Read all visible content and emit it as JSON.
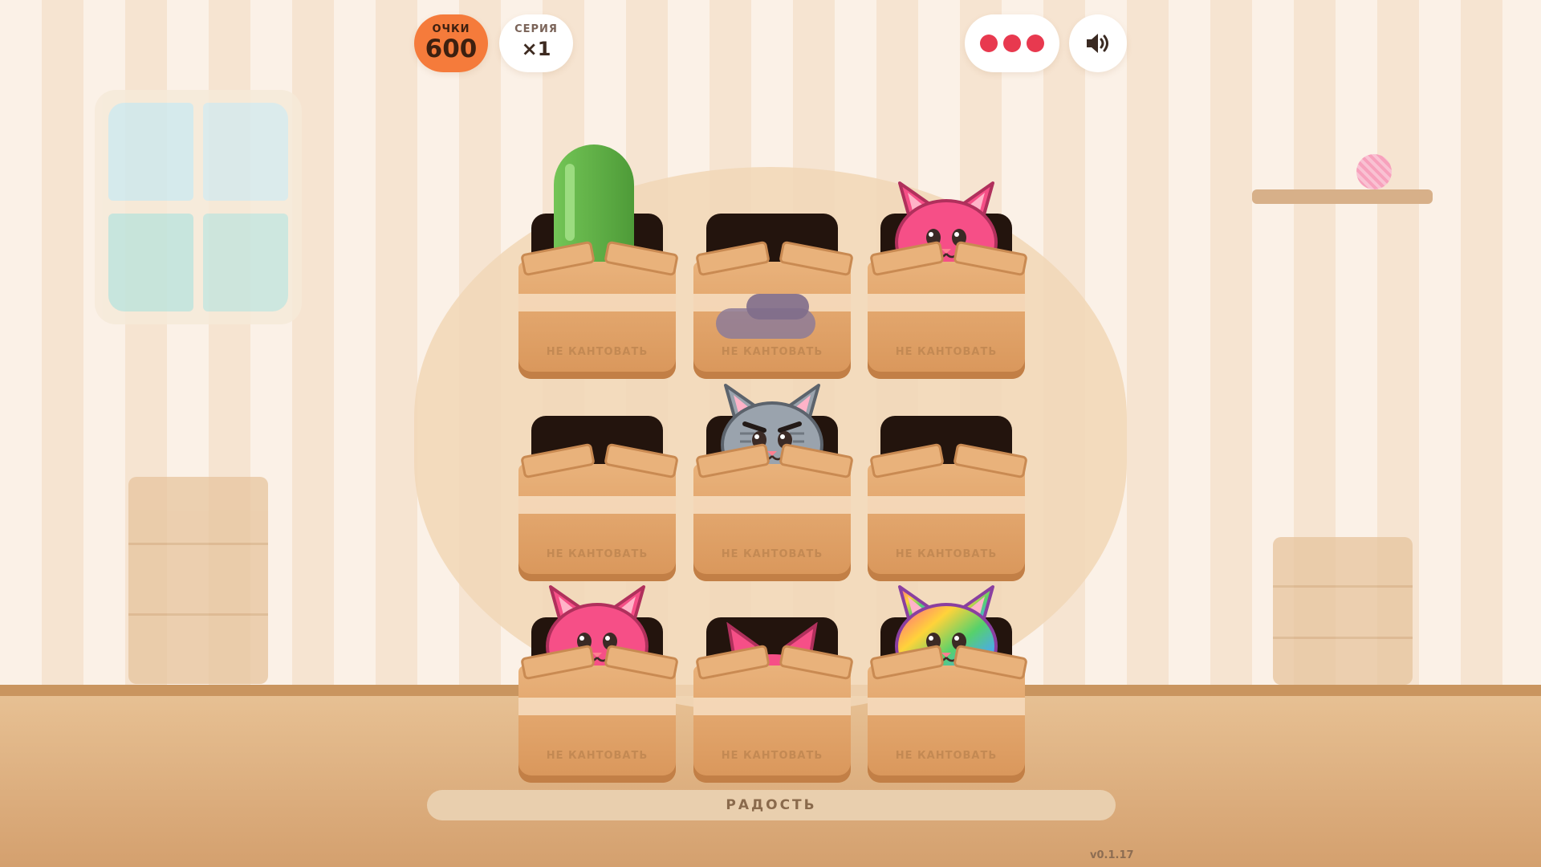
{
  "hud": {
    "score_label": "ОЧКИ",
    "score_value": "600",
    "combo_label": "СЕРИЯ",
    "combo_value": "×1",
    "lives": 3,
    "sound_icon": "speaker-volume-icon"
  },
  "colors": {
    "accent": "#f57b3b",
    "life": "#e8394f",
    "cat_pink": "#f64f87",
    "cat_grey": "#9aa3ad",
    "box": "#e9b27b"
  },
  "grid": {
    "rows": 3,
    "cols": 3,
    "stamp_text": "НЕ КАНТОВАТЬ",
    "cells": [
      {
        "content": "cactus"
      },
      {
        "content": "empty"
      },
      {
        "content": "pink-cat"
      },
      {
        "content": "empty"
      },
      {
        "content": "grey-angry-cat"
      },
      {
        "content": "empty"
      },
      {
        "content": "pink-cat"
      },
      {
        "content": "pink-cat-ears"
      },
      {
        "content": "rainbow-cat"
      }
    ]
  },
  "joy_bar": {
    "label": "РАДОСТЬ",
    "fill": 0
  },
  "version": "v0.1.17"
}
